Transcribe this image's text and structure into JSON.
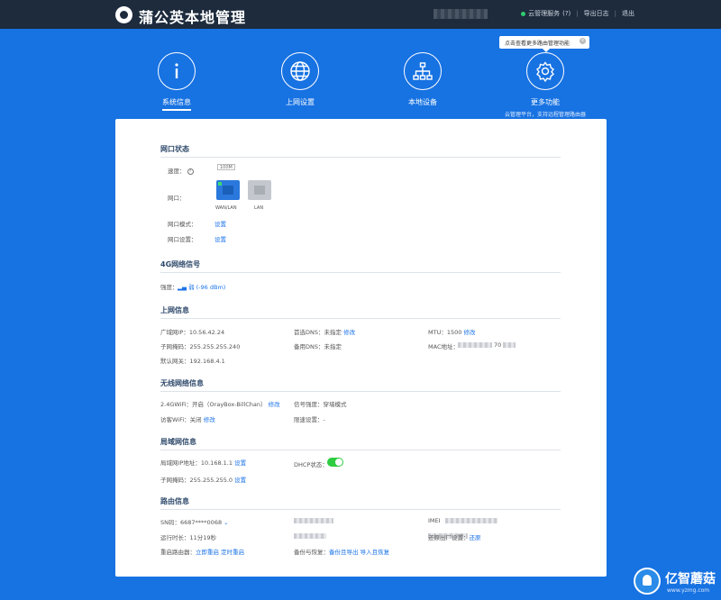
{
  "header": {
    "app_title": "蒲公英本地管理",
    "cloud_service": "云管理服务",
    "cloud_help": "(?)",
    "export_log": "导出日志",
    "logout": "退出"
  },
  "nav": {
    "items": [
      {
        "label": "系统信息",
        "icon": "info-icon"
      },
      {
        "label": "上网设置",
        "icon": "globe-icon"
      },
      {
        "label": "本地设备",
        "icon": "network-icon"
      },
      {
        "label": "更多功能",
        "icon": "gear-icon",
        "sub": "云管理平台，支持远程管理路由器"
      }
    ]
  },
  "tooltip": "点击查看更多路由管理功能",
  "port_status": {
    "title": "网口状态",
    "speed_label": "速度：",
    "speed_value": "100M",
    "ports_label": "网口：",
    "wan_label": "WAN/LAN",
    "lan_label": "LAN",
    "mode_label": "网口模式：",
    "mode_action": "设置",
    "settings_label": "网口设置：",
    "settings_action": "设置"
  },
  "signal_4g": {
    "title": "4G网络信号",
    "strength_label": "强度：",
    "strength_value": "弱 (-96 dBm)"
  },
  "internet": {
    "title": "上网信息",
    "wan_ip_label": "广域网IP：",
    "wan_ip": "10.56.42.24",
    "subnet_label": "子网掩码：",
    "subnet": "255.255.255.240",
    "gateway_label": "默认网关：",
    "gateway": "192.168.4.1",
    "dns1_label": "首选DNS：",
    "dns1": "未指定",
    "dns1_action": "修改",
    "dns2_label": "备用DNS：",
    "dns2": "未指定",
    "mtu_label": "MTU：",
    "mtu": "1500",
    "mtu_action": "修改",
    "mac_label": "MAC地址：",
    "mac_tail": "70"
  },
  "wireless": {
    "title": "无线网络信息",
    "wifi24_label": "2.4GWiFi：",
    "wifi24_value": "开启（OrayBox-BillChan）",
    "wifi24_action": "修改",
    "guest_label": "访客WiFi：",
    "guest_value": "关闭",
    "guest_action": "修改",
    "signal_label": "信号强度：",
    "signal_value": "穿墙模式",
    "speedlimit_label": "限速设置：",
    "speedlimit_value": "-"
  },
  "lan": {
    "title": "局域网信息",
    "ip_label": "局域网IP地址：",
    "ip": "10.168.1.1",
    "ip_action": "设置",
    "subnet_label": "子网掩码：",
    "subnet": "255.255.255.0",
    "subnet_action": "设置",
    "dhcp_label": "DHCP状态：",
    "dhcp_on": true
  },
  "router": {
    "title": "路由信息",
    "sn_label": "SN码：",
    "sn": "6687****0068",
    "uptime_label": "运行时长：",
    "uptime": "11分19秒",
    "reboot_label": "重启路由器：",
    "reboot_now": "立即重启",
    "reboot_timed": "定时重启",
    "backup_label": "备份与恢复：",
    "backup_export": "备份且导出",
    "backup_import": "导入且恢复",
    "imei_label": "IMEI",
    "factory_label": "还原出厂设置：",
    "factory_action": "还原"
  },
  "watermark": {
    "name": "亿智蘑菇",
    "url": "www.yzmg.com"
  }
}
